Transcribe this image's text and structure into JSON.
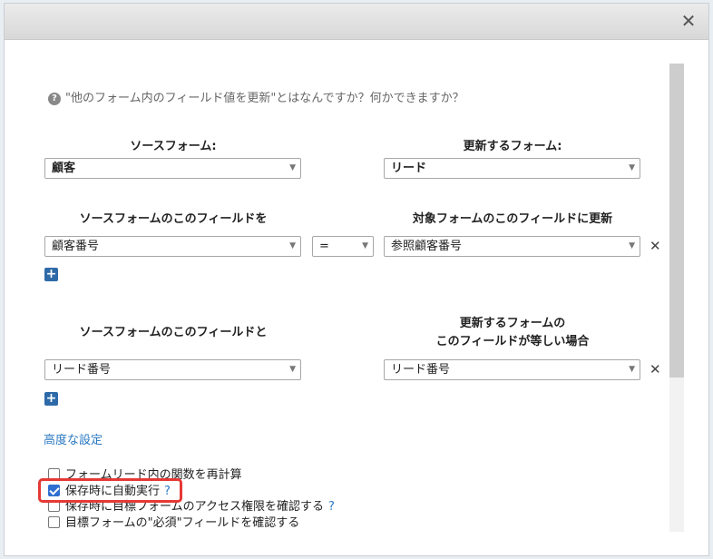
{
  "dialog": {
    "close_glyph": "✕"
  },
  "help": {
    "icon": "question-circle-icon",
    "text": "\"他のフォーム内のフィールド値を更新\"とはなんですか？何かできますか？"
  },
  "source_form": {
    "label": "ソースフォーム:",
    "value": "顧客"
  },
  "target_form": {
    "label": "更新するフォーム:",
    "value": "リード"
  },
  "mapping": {
    "source_label": "ソースフォームのこのフィールドを",
    "target_label": "対象フォームのこのフィールドに更新",
    "source_value": "顧客番号",
    "operator": "=",
    "target_value": "参照顧客番号",
    "remove_glyph": "✕",
    "add_glyph": "+"
  },
  "match": {
    "source_label": "ソースフォームのこのフィールドと",
    "target_label_line1": "更新するフォームの",
    "target_label_line2": "このフィールドが等しい場合",
    "source_value": "リード番号",
    "target_value": "リード番号",
    "remove_glyph": "✕",
    "add_glyph": "+"
  },
  "advanced": {
    "link_label": "高度な設定",
    "options": [
      {
        "label": "フォームリード内の関数を再計算",
        "checked": false,
        "help": ""
      },
      {
        "label": "保存時に自動実行",
        "checked": true,
        "help": "?"
      },
      {
        "label": "保存時に目標フォームのアクセス権限を確認する",
        "checked": false,
        "help": "?"
      },
      {
        "label": "目標フォームの\"必須\"フィールドを確認する",
        "checked": false,
        "help": ""
      }
    ]
  },
  "colors": {
    "accent": "#2a78c1",
    "highlight": "#e53935",
    "checkbox_checked": "#2f6fd0"
  }
}
